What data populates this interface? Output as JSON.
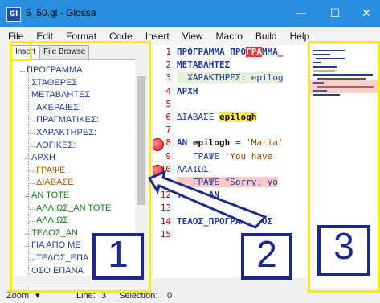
{
  "window": {
    "title": "5_50.gl - Glossa",
    "app_icon": "Gl"
  },
  "window_controls": {
    "minimize": "—",
    "maximize": "☐",
    "close": "✕"
  },
  "menu": [
    "File",
    "Edit",
    "Format",
    "Code",
    "Insert",
    "View",
    "Macro",
    "Build",
    "Help"
  ],
  "left_panel": {
    "tabs": [
      "Insert",
      "File Browse"
    ],
    "items": [
      {
        "label": "ΠΡΟΓΡΑΜΜΑ",
        "color": "#1d3d99"
      },
      {
        "label": "ΣΤΑΘΕΡΕΣ",
        "color": "#1d3d99"
      },
      {
        "label": "ΜΕΤΑΒΛΗΤΕΣ",
        "color": "#1d3d99"
      },
      {
        "label": "ΑΚΕΡΑΙΕΣ:",
        "color": "#1d3d99"
      },
      {
        "label": "ΠΡΑΓΜΑΤΙΚΕΣ:",
        "color": "#1d3d99"
      },
      {
        "label": "ΧΑΡΑΚΤΗΡΕΣ:",
        "color": "#1d3d99"
      },
      {
        "label": "ΛΟΓΙΚΕΣ:",
        "color": "#1d3d99"
      },
      {
        "label": "ΑΡΧΗ",
        "color": "#1d3d99"
      },
      {
        "label": "ΓΡΑΨΕ",
        "color": "#b35a00"
      },
      {
        "label": "ΔΙΑΒΑΣΕ",
        "color": "#b35a00"
      },
      {
        "label": "ΑΝ ΤΟΤΕ",
        "color": "#1a7a1a"
      },
      {
        "label": "ΑΛΛΙΩΣ_ΑΝ ΤΟΤΕ",
        "color": "#1a7a1a"
      },
      {
        "label": "ΑΛΛΙΩΣ",
        "color": "#1a7a1a"
      },
      {
        "label": "ΤΕΛΟΣ_ΑΝ",
        "color": "#1a7a1a"
      },
      {
        "label": "ΓΙΑ ΑΠΟ ΜΕ",
        "color": "#1d3d99"
      },
      {
        "label": "ΤΕΛΟΣ_ΕΠΑ",
        "color": "#1d3d99"
      },
      {
        "label": "ΟΣΟ ΕΠΑΝΑ",
        "color": "#1d3d99"
      }
    ]
  },
  "editor": {
    "lines": [
      {
        "n": "1",
        "text": "ΠΡΟΓΡΑΜΜΑ ΠΡΟΓΡΑΜΜΑ_"
      },
      {
        "n": "2",
        "text": "ΜΕΤΑΒΛΗΤΕΣ"
      },
      {
        "n": "3",
        "text": "  ΧΑΡΑΚΤΗΡΕΣ: epilog"
      },
      {
        "n": "4",
        "text": "ΑΡΧΗ"
      },
      {
        "n": "5",
        "text": ""
      },
      {
        "n": "6",
        "text": "ΔΙΑΒΑΣΕ epilogh"
      },
      {
        "n": "7",
        "text": ""
      },
      {
        "n": "8",
        "text": "ΑΝ epilogh = 'Maria'"
      },
      {
        "n": "9",
        "text": "   ΓΡΑΨΕ 'You have"
      },
      {
        "n": "10",
        "text": "ΑΛΛΙΩΣ"
      },
      {
        "n": "11",
        "text": "   ΓΡΑΨΕ \"Sorry, yo"
      },
      {
        "n": "12",
        "text": "ΤΕΛΟΣ_ΑΝ"
      },
      {
        "n": "13",
        "text": ""
      },
      {
        "n": "14",
        "text": "ΤΕΛΟΣ_ΠΡΟΓΡΑΜΜΑΤΟΣ"
      },
      {
        "n": "15",
        "text": ""
      }
    ],
    "breakpoint_lines": [
      "8",
      "10"
    ]
  },
  "status": {
    "zoom": "Zoom",
    "line_label": "Line:",
    "line_value": "3",
    "selection_label": "Selection:",
    "selection_value": "0"
  },
  "annotations": {
    "labels": [
      "1",
      "2",
      "3"
    ],
    "box_color": "#f5f000",
    "number_color": "#1b2a8a"
  }
}
